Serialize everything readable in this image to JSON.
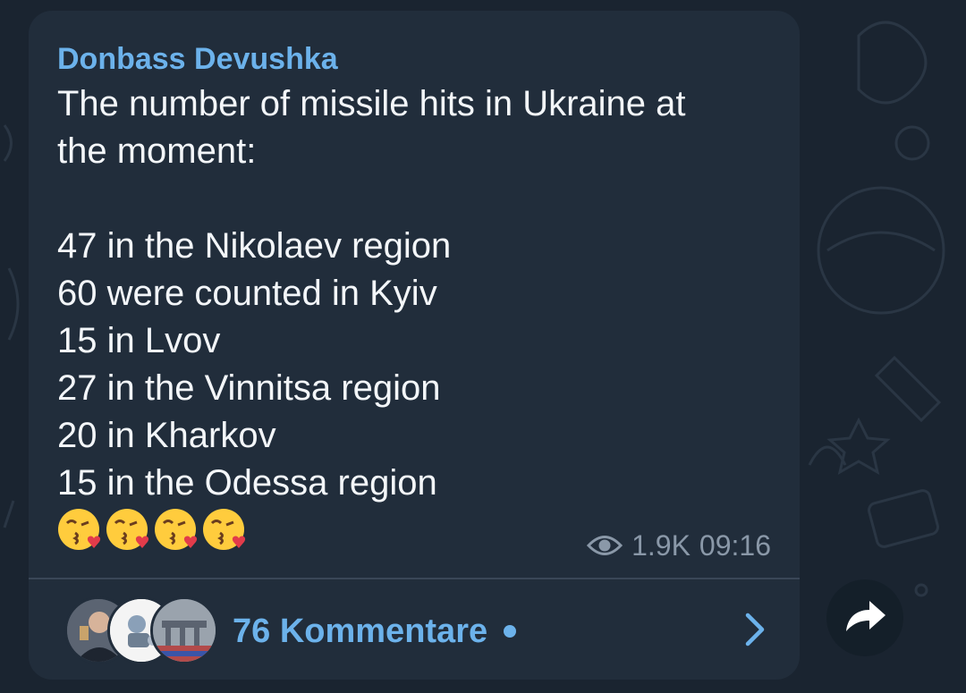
{
  "post": {
    "channel_name": "Donbass Devushka",
    "lines": [
      "The number of missile hits in Ukraine at",
      "the moment:",
      "",
      "47 in the Nikolaev region",
      "60 were counted in Kyiv",
      "15 in Lvov",
      "27 in the Vinnitsa region",
      "20 in Kharkov",
      "15 in the Odessa region"
    ],
    "emoji": [
      "kissing-face-with-heart",
      "kissing-face-with-heart",
      "kissing-face-with-heart",
      "kissing-face-with-heart"
    ],
    "views": "1.9K",
    "time": "09:16",
    "view_icon": "eye-icon"
  },
  "comments_bar": {
    "label": "76 Kommentare",
    "has_unread": true,
    "chevron_icon": "chevron-right-icon"
  },
  "share_button": {
    "icon": "share-arrow-icon"
  },
  "colors": {
    "background": "#1a2430",
    "bubble": "#212d3b",
    "accent": "#6cb2eb",
    "text": "#f3f6f9",
    "meta": "#8a98a8"
  }
}
